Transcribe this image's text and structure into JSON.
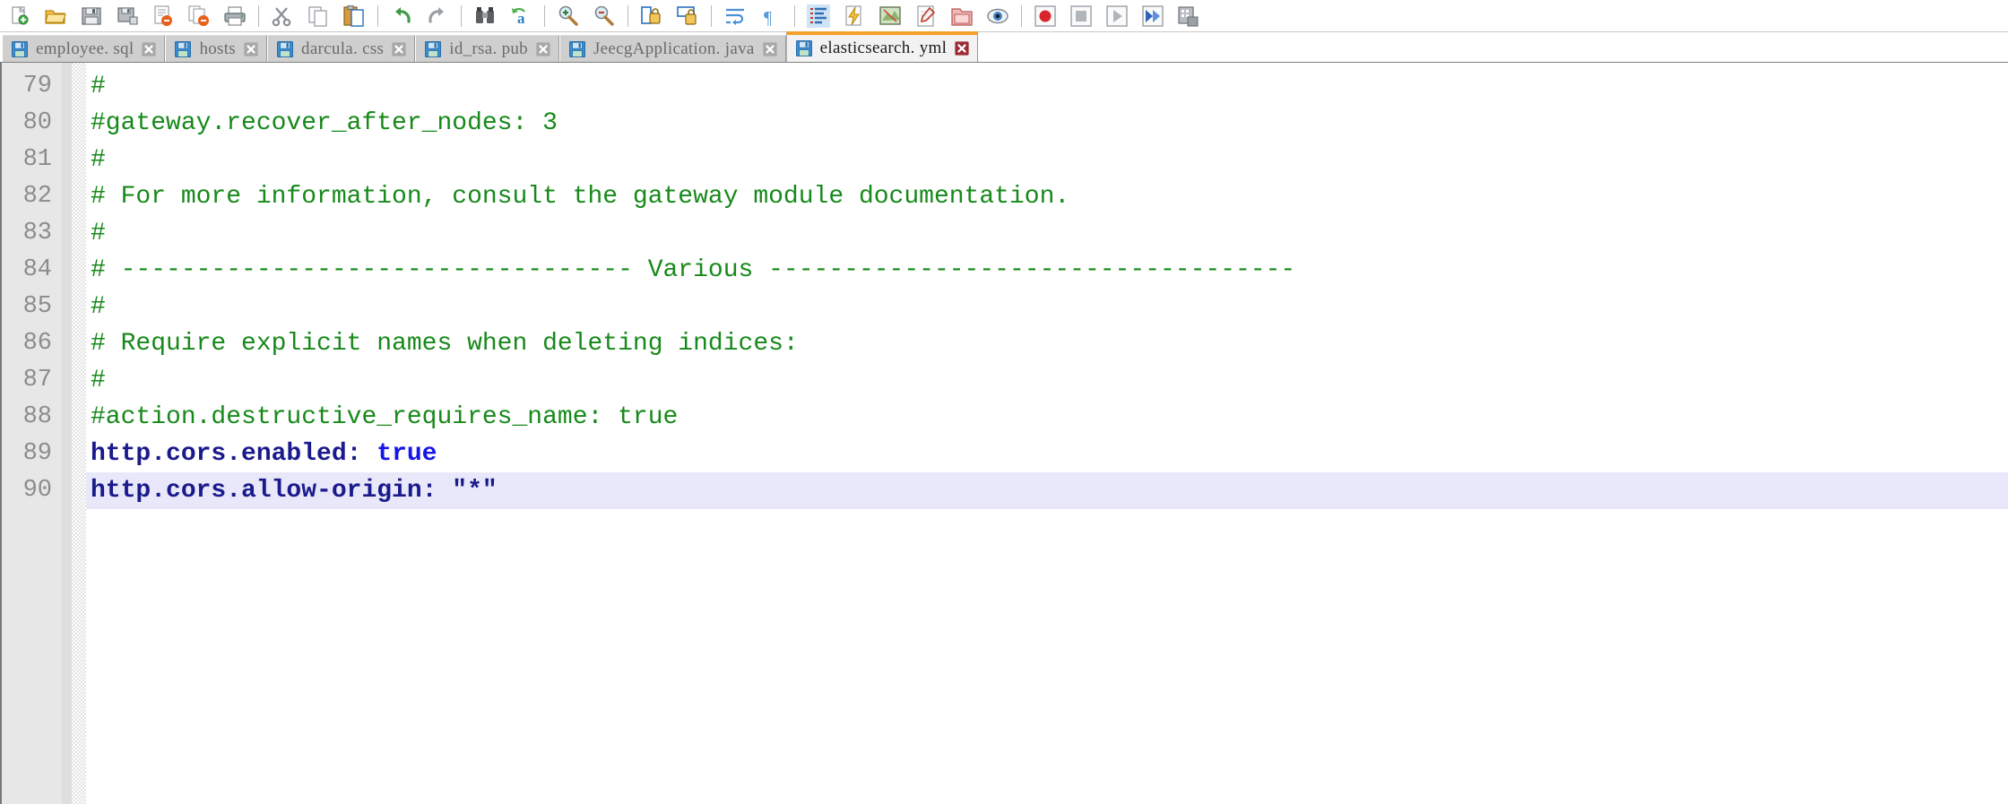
{
  "toolbar": {
    "groups": [
      {
        "name": "file-group",
        "buttons": [
          {
            "name": "new-file-button",
            "icon": "new-file-icon",
            "label": "New"
          },
          {
            "name": "open-file-button",
            "icon": "open-folder-icon",
            "label": "Open"
          },
          {
            "name": "save-button",
            "icon": "save-disk-icon",
            "label": "Save"
          },
          {
            "name": "save-as-button",
            "icon": "save-as-disk-icon",
            "label": "Save As"
          },
          {
            "name": "close-file-button",
            "icon": "close-document-icon",
            "label": "Close"
          },
          {
            "name": "close-all-button",
            "icon": "close-all-documents-icon",
            "label": "Close All"
          },
          {
            "name": "print-button",
            "icon": "printer-icon",
            "label": "Print"
          }
        ]
      },
      {
        "name": "edit-group",
        "buttons": [
          {
            "name": "cut-button",
            "icon": "scissors-icon",
            "label": "Cut"
          },
          {
            "name": "copy-button",
            "icon": "copy-pages-icon",
            "label": "Copy"
          },
          {
            "name": "paste-button",
            "icon": "paste-clipboard-icon",
            "label": "Paste"
          }
        ]
      },
      {
        "name": "history-group",
        "buttons": [
          {
            "name": "undo-button",
            "icon": "undo-arrow-icon",
            "label": "Undo"
          },
          {
            "name": "redo-button",
            "icon": "redo-arrow-icon",
            "label": "Redo"
          }
        ]
      },
      {
        "name": "search-group",
        "buttons": [
          {
            "name": "find-button",
            "icon": "binoculars-icon",
            "label": "Find"
          },
          {
            "name": "replace-button",
            "icon": "replace-ab-icon",
            "label": "Replace"
          }
        ]
      },
      {
        "name": "zoom-group",
        "buttons": [
          {
            "name": "zoom-in-button",
            "icon": "magnifier-plus-icon",
            "label": "Zoom In"
          },
          {
            "name": "zoom-out-button",
            "icon": "magnifier-minus-icon",
            "label": "Zoom Out"
          }
        ]
      },
      {
        "name": "sync-group",
        "buttons": [
          {
            "name": "sync-vertical-button",
            "icon": "sync-lock-vertical-icon",
            "label": "Sync Vertical Scrolling"
          },
          {
            "name": "sync-horizontal-button",
            "icon": "sync-lock-horizontal-icon",
            "label": "Sync Horizontal Scrolling"
          }
        ]
      },
      {
        "name": "view-group",
        "buttons": [
          {
            "name": "word-wrap-button",
            "icon": "word-wrap-icon",
            "label": "Word Wrap"
          },
          {
            "name": "show-all-chars-button",
            "icon": "pilcrow-icon",
            "label": "Show All Characters"
          }
        ]
      },
      {
        "name": "tools-group",
        "buttons": [
          {
            "name": "indent-guide-button",
            "icon": "indent-guide-icon",
            "label": "Indent Guide",
            "active": true
          },
          {
            "name": "user-defined-language-button",
            "icon": "lightning-page-icon",
            "label": "User Defined Language"
          },
          {
            "name": "document-map-button",
            "icon": "document-map-icon",
            "label": "Document Map"
          },
          {
            "name": "function-list-button",
            "icon": "function-list-icon",
            "label": "Function List"
          },
          {
            "name": "folder-as-workspace-button",
            "icon": "folder-workspace-icon",
            "label": "Folder as Workspace"
          },
          {
            "name": "monitoring-button",
            "icon": "eye-monitor-icon",
            "label": "Monitoring"
          }
        ]
      },
      {
        "name": "macro-group",
        "buttons": [
          {
            "name": "record-macro-button",
            "icon": "record-red-dot-icon",
            "label": "Start Recording"
          },
          {
            "name": "stop-macro-button",
            "icon": "stop-square-icon",
            "label": "Stop Recording"
          },
          {
            "name": "play-macro-button",
            "icon": "play-triangle-icon",
            "label": "Playback"
          },
          {
            "name": "run-macro-multiple-button",
            "icon": "fast-forward-icon",
            "label": "Run a Macro Multiple Times"
          },
          {
            "name": "save-macro-button",
            "icon": "save-macro-icon",
            "label": "Save Current Recorded Macro"
          }
        ]
      }
    ]
  },
  "tabs": [
    {
      "name": "tab-employee-sql",
      "label": "employee. sql",
      "icon": "floppy-disk-icon",
      "close_icon": "close-x-icon",
      "active": false
    },
    {
      "name": "tab-hosts",
      "label": "hosts",
      "icon": "floppy-disk-icon",
      "close_icon": "close-x-icon",
      "active": false
    },
    {
      "name": "tab-darcula-css",
      "label": "darcula. css",
      "icon": "floppy-disk-icon",
      "close_icon": "close-x-icon",
      "active": false
    },
    {
      "name": "tab-id-rsa-pub",
      "label": "id_rsa. pub",
      "icon": "floppy-disk-icon",
      "close_icon": "close-x-icon",
      "active": false
    },
    {
      "name": "tab-jeecgapplication-java",
      "label": "JeecgApplication. java",
      "icon": "floppy-disk-icon",
      "close_icon": "close-x-icon",
      "active": false
    },
    {
      "name": "tab-elasticsearch-yml",
      "label": "elasticsearch. yml",
      "icon": "floppy-disk-icon",
      "close_icon": "close-x-icon",
      "active": true
    }
  ],
  "editor": {
    "colors": {
      "comment": "#17891a",
      "key": "#1a1a8c",
      "boolean": "#1616e8",
      "string": "#1a1a8c",
      "current_line_highlight": "#e8e8fa",
      "gutter_background": "#e7e7e7",
      "line_number": "#8c8c8c",
      "active_tab_accent": "#f4a028"
    },
    "current_line": 90,
    "lines": [
      {
        "no": "79",
        "tokens": [
          {
            "t": "comment",
            "v": "#"
          }
        ]
      },
      {
        "no": "80",
        "tokens": [
          {
            "t": "comment",
            "v": "#gateway.recover_after_nodes: 3"
          }
        ]
      },
      {
        "no": "81",
        "tokens": [
          {
            "t": "comment",
            "v": "#"
          }
        ]
      },
      {
        "no": "82",
        "tokens": [
          {
            "t": "comment",
            "v": "# For more information, consult the gateway module documentation."
          }
        ]
      },
      {
        "no": "83",
        "tokens": [
          {
            "t": "comment",
            "v": "#"
          }
        ]
      },
      {
        "no": "84",
        "tokens": [
          {
            "t": "comment",
            "v": "# ---------------------------------- Various -----------------------------------"
          }
        ]
      },
      {
        "no": "85",
        "tokens": [
          {
            "t": "comment",
            "v": "#"
          }
        ]
      },
      {
        "no": "86",
        "tokens": [
          {
            "t": "comment",
            "v": "# Require explicit names when deleting indices:"
          }
        ]
      },
      {
        "no": "87",
        "tokens": [
          {
            "t": "comment",
            "v": "#"
          }
        ]
      },
      {
        "no": "88",
        "tokens": [
          {
            "t": "comment",
            "v": "#action.destructive_requires_name: true"
          }
        ]
      },
      {
        "no": "89",
        "tokens": [
          {
            "t": "key",
            "v": "http.cors.enabled: "
          },
          {
            "t": "bool",
            "v": "true"
          }
        ]
      },
      {
        "no": "90",
        "tokens": [
          {
            "t": "key",
            "v": "http.cors.allow-origin: "
          },
          {
            "t": "string",
            "v": "\"*\""
          }
        ]
      }
    ]
  }
}
